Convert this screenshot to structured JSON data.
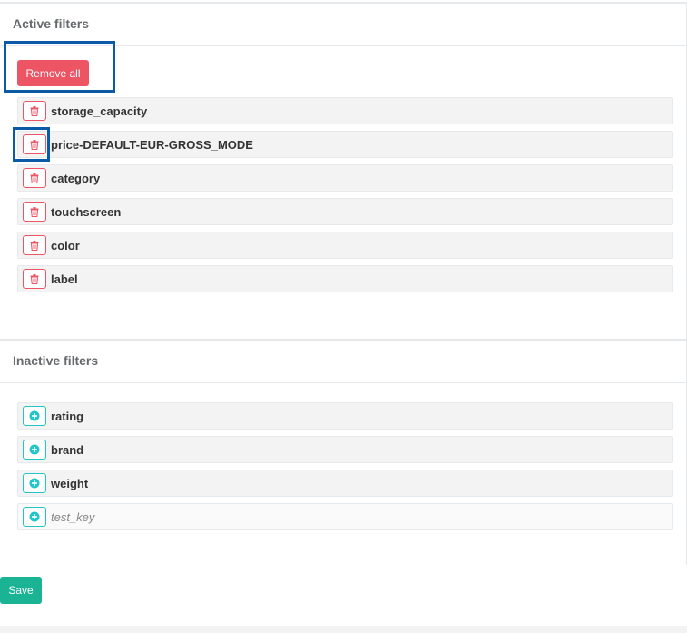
{
  "active": {
    "title": "Active filters",
    "remove_all_label": "Remove all",
    "filters": [
      {
        "label": "storage_capacity",
        "icon": "trash-icon"
      },
      {
        "label": "price-DEFAULT-EUR-GROSS_MODE",
        "icon": "trash-icon"
      },
      {
        "label": "category",
        "icon": "trash-icon"
      },
      {
        "label": "touchscreen",
        "icon": "trash-icon"
      },
      {
        "label": "color",
        "icon": "trash-icon"
      },
      {
        "label": "label",
        "icon": "trash-icon"
      }
    ]
  },
  "inactive": {
    "title": "Inactive filters",
    "filters": [
      {
        "label": "rating",
        "icon": "plus-circle-icon"
      },
      {
        "label": "brand",
        "icon": "plus-circle-icon"
      },
      {
        "label": "weight",
        "icon": "plus-circle-icon"
      },
      {
        "label": "test_key",
        "icon": "plus-circle-icon",
        "style": "italic placeholder"
      }
    ]
  },
  "footer": {
    "save_label": "Save"
  },
  "colors": {
    "danger": "#ed5565",
    "info": "#23c6c8",
    "primary": "#1ab394",
    "highlight": "#0b5aa7",
    "row_bg": "#f3f3f4"
  }
}
